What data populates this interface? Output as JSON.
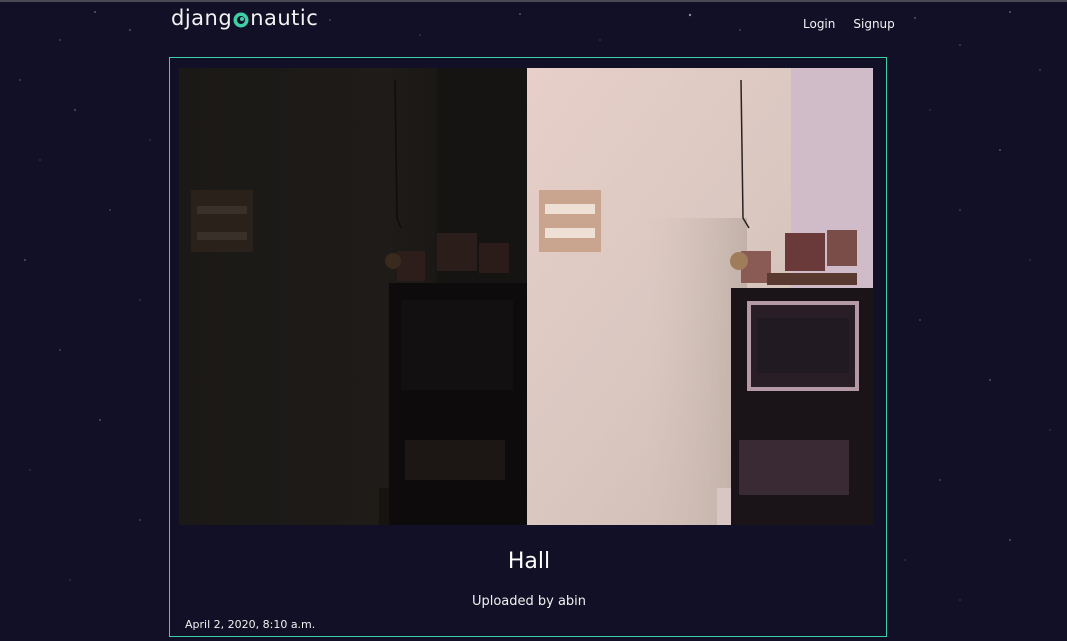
{
  "header": {
    "logo_prefix": "djang",
    "logo_suffix": "nautic",
    "nav": {
      "login": "Login",
      "signup": "Signup"
    }
  },
  "post": {
    "title": "Hall",
    "uploaded_by": "Uploaded by abin",
    "date": "April 2, 2020, 8:10 a.m."
  },
  "colors": {
    "background": "#121026",
    "accent": "#3fcfa6"
  }
}
